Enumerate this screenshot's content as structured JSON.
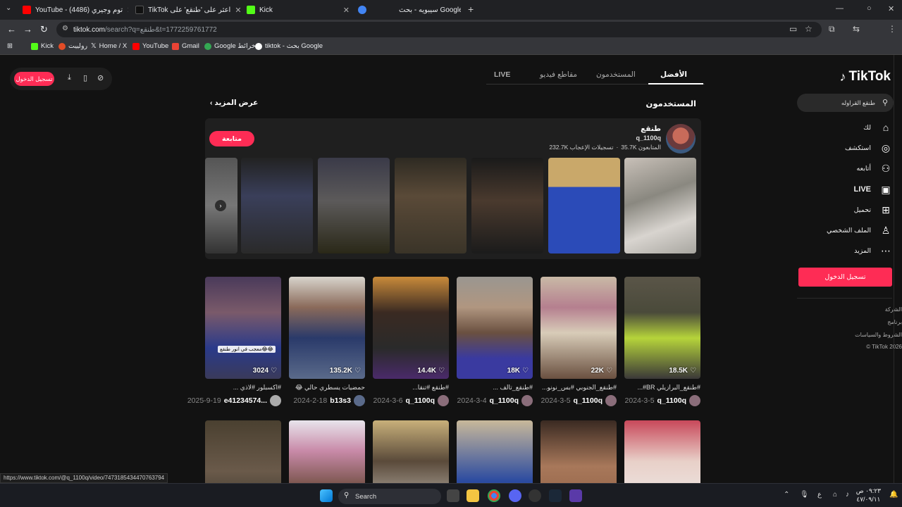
{
  "browser": {
    "tabs": [
      {
        "title": "YouTube - (4486) توم وجيري",
        "color": "#ff0000"
      },
      {
        "title": "TikTok اعثر على 'طنقع' على",
        "color": "#111111"
      },
      {
        "title": "Kick",
        "color": "#53fc18"
      },
      {
        "title": "",
        "color": "#cccccc"
      },
      {
        "title": "سيبويه - بحث Google",
        "color": "#4285f4"
      }
    ],
    "url_host": "tiktok.com",
    "url_path": "/search?q=طنقع&t=1772259761772",
    "bookmarks": [
      {
        "label": "Kick",
        "color": "#53fc18"
      },
      {
        "label": "رولييت",
        "color": "#e34c26"
      },
      {
        "label": "Home / X",
        "color": "#ffffff"
      },
      {
        "label": "YouTube",
        "color": "#ff0000"
      },
      {
        "label": "Gmail",
        "color": "#ea4335"
      },
      {
        "label": "Google خرائط",
        "color": "#34a853"
      },
      {
        "label": "tiktok - بحث Google",
        "color": "#ffffff"
      }
    ]
  },
  "sidebar": {
    "logo": "TikTok",
    "search_text": "طنقع القراوله",
    "items": [
      {
        "label": "لك",
        "icon": "home-icon",
        "glyph": "⌂"
      },
      {
        "label": "استكشف",
        "icon": "compass-icon",
        "glyph": "◎"
      },
      {
        "label": "أتابعه",
        "icon": "user-follow-icon",
        "glyph": "⚇"
      },
      {
        "label": "LIVE",
        "icon": "live-icon",
        "glyph": "▣"
      },
      {
        "label": "تحميل",
        "icon": "upload-icon",
        "glyph": "⊞"
      },
      {
        "label": "الملف الشخصي",
        "icon": "profile-icon",
        "glyph": "♙"
      },
      {
        "label": "المزيد",
        "icon": "more-icon",
        "glyph": "⋯"
      }
    ],
    "login": "تسجيل الدخول",
    "footer": [
      "الشركة",
      "برنامج",
      "الشروط والسياسات",
      "© TikTok 2026"
    ]
  },
  "leftbar": {
    "login": "تسجيل الدخول"
  },
  "search_tabs": [
    "الأفضل",
    "المستخدمون",
    "مقاطع فيديو",
    "LIVE"
  ],
  "users_section": {
    "title": "المستخدمون",
    "more": "عرض المزيد"
  },
  "user": {
    "name": "طنقع",
    "handle": "q_1100q",
    "followers": "35.7K المتابعون",
    "likes": "232.7K تسجيلات الإعجاب",
    "follow_label": "متابعة"
  },
  "videos": [
    {
      "likes": "18.5K",
      "caption": "#طنقع_البرازيلي BR#...",
      "author": "q_1100q",
      "date": "2024-3-5"
    },
    {
      "likes": "22K",
      "caption": "#طنقع_الجنوبي #بس_نونو...",
      "author": "q_1100q",
      "date": "2024-3-5"
    },
    {
      "likes": "18K",
      "caption": "#طنقع_تالف ...",
      "author": "q_1100q",
      "date": "2024-3-4"
    },
    {
      "likes": "14.4K",
      "caption": "#طنقع #تنقا...",
      "author": "q_1100q",
      "date": "2024-3-6"
    },
    {
      "likes": "135.2K",
      "caption": "حمضيات يسطري حالي 😂",
      "author": "b13s3",
      "date": "2024-2-18"
    },
    {
      "likes": "3024",
      "caption": "#اكسبلور #لاذي ...",
      "author": "e41234574...",
      "date": "2025-9-19",
      "tag": "معجب في انور طنقع😂😂"
    }
  ],
  "status_url": "https://www.tiktok.com/@q_1100q/video/7473185434470763794",
  "taskbar": {
    "search": "Search",
    "clock_time": "٠٩:٢٣ ص",
    "clock_date": "٤٧/٠٩/١١",
    "lang": "ع"
  }
}
